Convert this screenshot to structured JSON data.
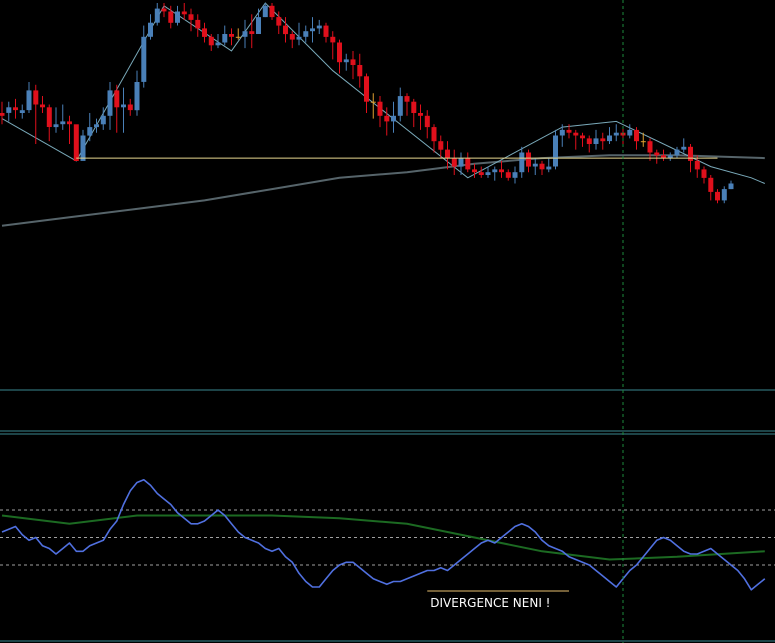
{
  "chart_data": {
    "type": "candlestick",
    "colors": {
      "background": "#000000",
      "bull": "#4a80b8",
      "bear": "#e0101c",
      "doji": "#e0a030",
      "zigzag": "#7aaaba",
      "support": "#e8d890",
      "moving_average": "#56646a",
      "separator": "#3a8890",
      "crosshair": "#1c8a3c",
      "oscillator": "#5070e0",
      "signal": "#1c6a22",
      "levels": "#a0a0a0",
      "annotation_line": "#e8c070",
      "annotation_text": "#ffffff"
    },
    "price_panel": {
      "ylim": [
        0,
        100
      ],
      "candles": [
        [
          61,
          60,
          65,
          57
        ],
        [
          61,
          63,
          65,
          58
        ],
        [
          63,
          62,
          66,
          59
        ],
        [
          61,
          62,
          64,
          59
        ],
        [
          62,
          69,
          72,
          61
        ],
        [
          69,
          64,
          71,
          50
        ],
        [
          64,
          63,
          67,
          61
        ],
        [
          63,
          56,
          64,
          51
        ],
        [
          56,
          57,
          63,
          54
        ],
        [
          57,
          58,
          64,
          55
        ],
        [
          58,
          57,
          60,
          50
        ],
        [
          57,
          44,
          52,
          44
        ],
        [
          44,
          53,
          55,
          46
        ],
        [
          53,
          56,
          61,
          51
        ],
        [
          56,
          57,
          59,
          54
        ],
        [
          57,
          60,
          63,
          55
        ],
        [
          60,
          69,
          72,
          55
        ],
        [
          69,
          63,
          71,
          54
        ],
        [
          63,
          64,
          70,
          54
        ],
        [
          64,
          62,
          66,
          60
        ],
        [
          62,
          72,
          76,
          60
        ],
        [
          72,
          88,
          92,
          70
        ],
        [
          88,
          93,
          96,
          87
        ],
        [
          93,
          98,
          100,
          92
        ],
        [
          98,
          97,
          100,
          95
        ],
        [
          97,
          93,
          99,
          91
        ],
        [
          93,
          97,
          99,
          92
        ],
        [
          97,
          96,
          100,
          94
        ],
        [
          96,
          94,
          98,
          90
        ],
        [
          94,
          91,
          96,
          88
        ],
        [
          91,
          88,
          93,
          86
        ],
        [
          88,
          85,
          89,
          83
        ],
        [
          85,
          86,
          89,
          84
        ],
        [
          86,
          89,
          92,
          85
        ],
        [
          89,
          88,
          91,
          85
        ],
        [
          88,
          88,
          91,
          87
        ],
        [
          88,
          90,
          94,
          84
        ],
        [
          90,
          89,
          96,
          84
        ],
        [
          89,
          95,
          98,
          89
        ],
        [
          95,
          99,
          100,
          95
        ],
        [
          99,
          95,
          100,
          94
        ],
        [
          95,
          92,
          97,
          89
        ],
        [
          92,
          89,
          95,
          86
        ],
        [
          89,
          87,
          90,
          84
        ],
        [
          87,
          88,
          93,
          85
        ],
        [
          88,
          90,
          92,
          86
        ],
        [
          90,
          91,
          95,
          86
        ],
        [
          91,
          92,
          94,
          89
        ],
        [
          92,
          88,
          93,
          86
        ],
        [
          88,
          86,
          90,
          80
        ],
        [
          86,
          79,
          87,
          75
        ],
        [
          79,
          80,
          82,
          76
        ],
        [
          80,
          78,
          83,
          73
        ],
        [
          78,
          74,
          82,
          70
        ],
        [
          74,
          65,
          75,
          61
        ],
        [
          65,
          65,
          68,
          59
        ],
        [
          65,
          60,
          67,
          56
        ],
        [
          60,
          58,
          63,
          53
        ],
        [
          58,
          60,
          65,
          54
        ],
        [
          60,
          67,
          70,
          58
        ],
        [
          67,
          65,
          68,
          60
        ],
        [
          65,
          61,
          66,
          56
        ],
        [
          61,
          60,
          64,
          55
        ],
        [
          60,
          56,
          62,
          52
        ],
        [
          56,
          51,
          57,
          47
        ],
        [
          51,
          48,
          53,
          45
        ],
        [
          48,
          45,
          51,
          41
        ],
        [
          45,
          42,
          48,
          39
        ],
        [
          42,
          45,
          47,
          39
        ],
        [
          45,
          41,
          47,
          40
        ],
        [
          41,
          40,
          43,
          38
        ],
        [
          40,
          39,
          42,
          38
        ],
        [
          39,
          40,
          42,
          38
        ],
        [
          40,
          41,
          42,
          37
        ],
        [
          41,
          40,
          44,
          38
        ],
        [
          40,
          38,
          41,
          37
        ],
        [
          38,
          40,
          42,
          36
        ],
        [
          40,
          47,
          49,
          38
        ],
        [
          47,
          42,
          48,
          40
        ],
        [
          42,
          43,
          45,
          39
        ],
        [
          43,
          41,
          44,
          39
        ],
        [
          41,
          42,
          45,
          40
        ],
        [
          42,
          53,
          55,
          41
        ],
        [
          53,
          55,
          57,
          49
        ],
        [
          55,
          54,
          57,
          52
        ],
        [
          54,
          53,
          55,
          48
        ],
        [
          53,
          52,
          54,
          49
        ],
        [
          52,
          50,
          53,
          47
        ],
        [
          50,
          52,
          55,
          48
        ],
        [
          52,
          51,
          54,
          48
        ],
        [
          51,
          53,
          56,
          50
        ],
        [
          53,
          54,
          57,
          51
        ],
        [
          54,
          53,
          56,
          50
        ],
        [
          53,
          55,
          57,
          52
        ],
        [
          55,
          51,
          56,
          48
        ],
        [
          51,
          51,
          54,
          49
        ],
        [
          51,
          47,
          52,
          44
        ],
        [
          47,
          46,
          48,
          43
        ],
        [
          46,
          45,
          48,
          44
        ],
        [
          45,
          46,
          47,
          44
        ],
        [
          46,
          48,
          49,
          45
        ],
        [
          48,
          49,
          52,
          47
        ],
        [
          49,
          44,
          50,
          40
        ],
        [
          44,
          41,
          46,
          38
        ],
        [
          41,
          38,
          42,
          36
        ],
        [
          38,
          33,
          39,
          30
        ],
        [
          33,
          30,
          34,
          29
        ],
        [
          30,
          34,
          35,
          29
        ],
        [
          34,
          36,
          37,
          34
        ]
      ],
      "zigzag": [
        [
          0,
          59
        ],
        [
          11,
          44
        ],
        [
          24,
          99
        ],
        [
          34,
          83
        ],
        [
          39,
          100
        ],
        [
          49,
          76
        ],
        [
          69,
          38
        ],
        [
          83,
          56
        ],
        [
          91,
          58
        ],
        [
          105,
          42
        ],
        [
          111,
          38
        ],
        [
          113,
          36
        ]
      ],
      "support": {
        "from": 11,
        "to": 106,
        "value": 45
      },
      "moving_average": [
        [
          0,
          21
        ],
        [
          10,
          24
        ],
        [
          20,
          27
        ],
        [
          30,
          30
        ],
        [
          40,
          34
        ],
        [
          50,
          38
        ],
        [
          60,
          40
        ],
        [
          70,
          43
        ],
        [
          80,
          45
        ],
        [
          90,
          46
        ],
        [
          100,
          46
        ],
        [
          113,
          45
        ]
      ]
    },
    "oscillator_panel": {
      "ylim": [
        -3,
        3
      ],
      "levels": [
        1,
        0,
        -1
      ],
      "oscillator": [
        0.2,
        0.3,
        0.4,
        0.1,
        -0.1,
        0.0,
        -0.3,
        -0.4,
        -0.6,
        -0.4,
        -0.2,
        -0.5,
        -0.5,
        -0.3,
        -0.2,
        -0.1,
        0.3,
        0.6,
        1.2,
        1.7,
        2.0,
        2.1,
        1.9,
        1.6,
        1.4,
        1.2,
        0.9,
        0.7,
        0.5,
        0.5,
        0.6,
        0.8,
        1.0,
        0.8,
        0.5,
        0.2,
        0.0,
        -0.1,
        -0.2,
        -0.4,
        -0.5,
        -0.4,
        -0.7,
        -0.9,
        -1.3,
        -1.6,
        -1.8,
        -1.8,
        -1.5,
        -1.2,
        -1.0,
        -0.9,
        -0.9,
        -1.1,
        -1.3,
        -1.5,
        -1.6,
        -1.7,
        -1.6,
        -1.6,
        -1.5,
        -1.4,
        -1.3,
        -1.2,
        -1.2,
        -1.1,
        -1.2,
        -1.0,
        -0.8,
        -0.6,
        -0.4,
        -0.2,
        -0.1,
        -0.2,
        0.0,
        0.2,
        0.4,
        0.5,
        0.4,
        0.2,
        -0.1,
        -0.3,
        -0.4,
        -0.5,
        -0.7,
        -0.8,
        -0.9,
        -1.0,
        -1.2,
        -1.4,
        -1.6,
        -1.8,
        -1.5,
        -1.2,
        -1.0,
        -0.7,
        -0.4,
        -0.1,
        0.0,
        -0.1,
        -0.3,
        -0.5,
        -0.6,
        -0.6,
        -0.5,
        -0.4,
        -0.6,
        -0.8,
        -1.0,
        -1.2,
        -1.5,
        -1.9,
        -1.7,
        -1.5
      ],
      "signal": [
        [
          0,
          0.8
        ],
        [
          10,
          0.5
        ],
        [
          20,
          0.8
        ],
        [
          30,
          0.8
        ],
        [
          40,
          0.8
        ],
        [
          50,
          0.7
        ],
        [
          60,
          0.5
        ],
        [
          70,
          0.0
        ],
        [
          80,
          -0.5
        ],
        [
          90,
          -0.8
        ],
        [
          100,
          -0.7
        ],
        [
          113,
          -0.5
        ]
      ]
    },
    "crosshair_bar": 92,
    "annotation": {
      "text": "DIVERGENCE NENI !",
      "from": 63,
      "to": 84
    }
  }
}
